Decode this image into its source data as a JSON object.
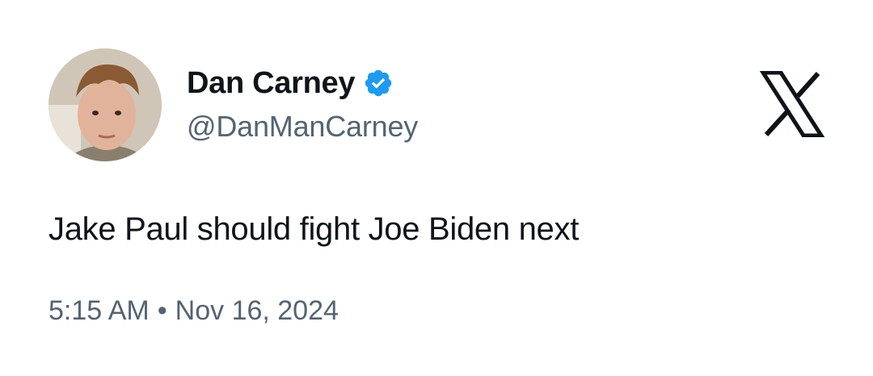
{
  "author": {
    "display_name": "Dan Carney",
    "handle": "@DanManCarney",
    "verified": true,
    "avatar_icon": "profile-photo"
  },
  "tweet": {
    "text": "Jake Paul should fight Joe Biden next",
    "time": "5:15 AM",
    "separator": "•",
    "date": "Nov 16, 2024"
  },
  "brand": {
    "logo_icon": "x-logo-icon"
  },
  "colors": {
    "text_primary": "#0f1419",
    "text_secondary": "#536471",
    "verified_blue": "#1d9bf0",
    "background": "#ffffff"
  }
}
